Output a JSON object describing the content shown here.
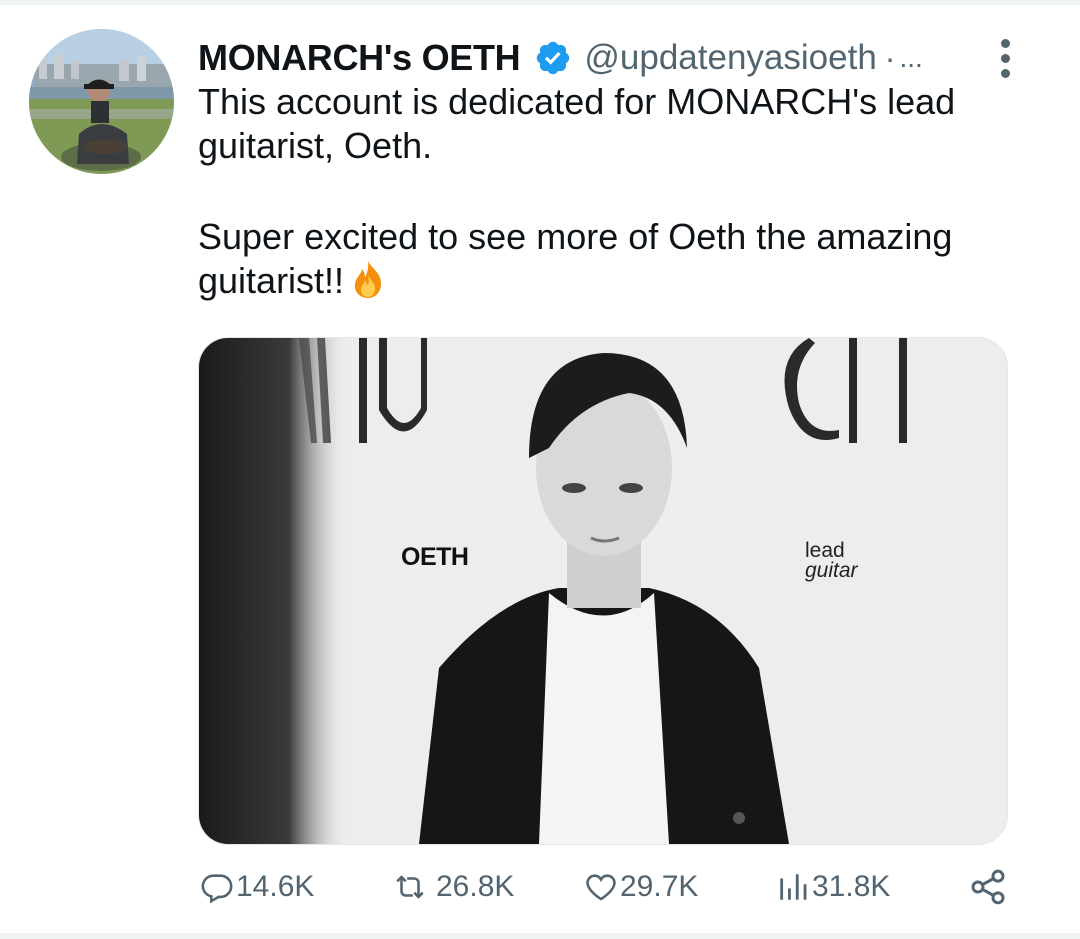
{
  "tweet": {
    "display_name": "MONARCH's OETH",
    "handle": "@updatenyasioeth",
    "separator": "·",
    "truncation": "...",
    "text_line_1": "This account is dedicated for MONARCH's lead guitarist, Oeth.",
    "text_line_2": "Super excited to see more of Oeth the amazing guitarist!!",
    "emoji": "fire-emoji"
  },
  "media": {
    "poster_brand": "MONARCH",
    "name_label": "OETH",
    "role_line_1": "lead",
    "role_line_2": "guitar"
  },
  "stats": {
    "replies": "14.6K",
    "retweets": "26.8K",
    "likes": "29.7K",
    "views": "31.8K"
  },
  "colors": {
    "text_primary": "#0f1419",
    "text_secondary": "#536471",
    "verified": "#1d9bf0"
  },
  "icons": {
    "verified": "verified-badge-icon",
    "more": "more-options-icon",
    "reply": "reply-icon",
    "retweet": "retweet-icon",
    "like": "heart-icon",
    "views": "views-chart-icon",
    "share": "share-icon"
  }
}
